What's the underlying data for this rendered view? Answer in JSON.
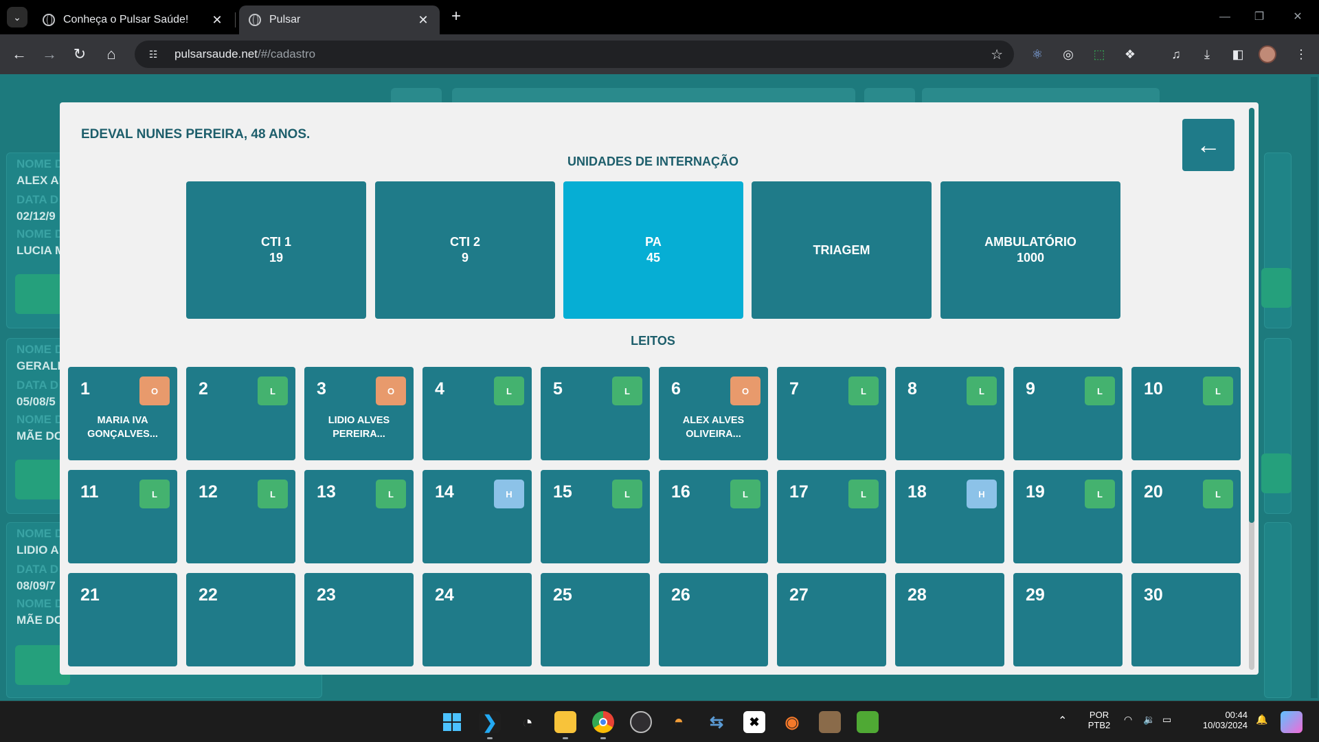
{
  "browser": {
    "tabs": [
      {
        "title": "Conheça o Pulsar Saúde!",
        "active": false
      },
      {
        "title": "Pulsar",
        "active": true
      }
    ],
    "url_host": "pulsarsaude.net",
    "url_path": "/#/cadastro"
  },
  "background_list": {
    "records": [
      {
        "lines": [
          "NOME D",
          "ALEX AL",
          "DATA D",
          "02/12/9",
          "NOME D",
          "LUCIA M"
        ]
      },
      {
        "lines": [
          "NOME D",
          "GERALD",
          "DATA D",
          "05/08/5",
          "NOME D",
          "MÃE DO"
        ]
      },
      {
        "lines": [
          "NOME D",
          "LIDIO A",
          "DATA D",
          "08/09/7",
          "NOME D",
          "MÃE DO"
        ]
      }
    ]
  },
  "modal": {
    "patient_title": "EDEVAL NUNES PEREIRA, 48 ANOS.",
    "units_heading": "UNIDADES DE INTERNAÇÃO",
    "beds_heading": "LEITOS",
    "units": [
      {
        "name": "CTI 1",
        "count": "19",
        "selected": false
      },
      {
        "name": "CTI 2",
        "count": "9",
        "selected": false
      },
      {
        "name": "PA",
        "count": "45",
        "selected": true
      },
      {
        "name": "TRIAGEM",
        "count": "",
        "selected": false
      },
      {
        "name": "AMBULATÓRIO",
        "count": "1000",
        "selected": false
      }
    ],
    "beds": [
      {
        "number": "1",
        "status": "O",
        "patient_line1": "MARIA IVA",
        "patient_line2": "GONÇALVES..."
      },
      {
        "number": "2",
        "status": "L",
        "patient_line1": "",
        "patient_line2": ""
      },
      {
        "number": "3",
        "status": "O",
        "patient_line1": "LIDIO ALVES",
        "patient_line2": "PEREIRA..."
      },
      {
        "number": "4",
        "status": "L",
        "patient_line1": "",
        "patient_line2": ""
      },
      {
        "number": "5",
        "status": "L",
        "patient_line1": "",
        "patient_line2": ""
      },
      {
        "number": "6",
        "status": "O",
        "patient_line1": "ALEX ALVES",
        "patient_line2": "OLIVEIRA..."
      },
      {
        "number": "7",
        "status": "L",
        "patient_line1": "",
        "patient_line2": ""
      },
      {
        "number": "8",
        "status": "L",
        "patient_line1": "",
        "patient_line2": ""
      },
      {
        "number": "9",
        "status": "L",
        "patient_line1": "",
        "patient_line2": ""
      },
      {
        "number": "10",
        "status": "L",
        "patient_line1": "",
        "patient_line2": ""
      },
      {
        "number": "11",
        "status": "L",
        "patient_line1": "",
        "patient_line2": ""
      },
      {
        "number": "12",
        "status": "L",
        "patient_line1": "",
        "patient_line2": ""
      },
      {
        "number": "13",
        "status": "L",
        "patient_line1": "",
        "patient_line2": ""
      },
      {
        "number": "14",
        "status": "H",
        "patient_line1": "",
        "patient_line2": ""
      },
      {
        "number": "15",
        "status": "L",
        "patient_line1": "",
        "patient_line2": ""
      },
      {
        "number": "16",
        "status": "L",
        "patient_line1": "",
        "patient_line2": ""
      },
      {
        "number": "17",
        "status": "L",
        "patient_line1": "",
        "patient_line2": ""
      },
      {
        "number": "18",
        "status": "H",
        "patient_line1": "",
        "patient_line2": ""
      },
      {
        "number": "19",
        "status": "L",
        "patient_line1": "",
        "patient_line2": ""
      },
      {
        "number": "20",
        "status": "L",
        "patient_line1": "",
        "patient_line2": ""
      },
      {
        "number": "21",
        "status": "",
        "patient_line1": "",
        "patient_line2": ""
      },
      {
        "number": "22",
        "status": "",
        "patient_line1": "",
        "patient_line2": ""
      },
      {
        "number": "23",
        "status": "",
        "patient_line1": "",
        "patient_line2": ""
      },
      {
        "number": "24",
        "status": "",
        "patient_line1": "",
        "patient_line2": ""
      },
      {
        "number": "25",
        "status": "",
        "patient_line1": "",
        "patient_line2": ""
      },
      {
        "number": "26",
        "status": "",
        "patient_line1": "",
        "patient_line2": ""
      },
      {
        "number": "27",
        "status": "",
        "patient_line1": "",
        "patient_line2": ""
      },
      {
        "number": "28",
        "status": "",
        "patient_line1": "",
        "patient_line2": ""
      },
      {
        "number": "29",
        "status": "",
        "patient_line1": "",
        "patient_line2": ""
      },
      {
        "number": "30",
        "status": "",
        "patient_line1": "",
        "patient_line2": ""
      }
    ]
  },
  "taskbar": {
    "lang_line1": "POR",
    "lang_line2": "PTB2",
    "time": "00:44",
    "date": "10/03/2024"
  },
  "colors": {
    "page_bg": "#1d7a7d",
    "card": "#1f7b89",
    "selected_unit": "#06aed4",
    "status_occupied": "#e89a6c",
    "status_free": "#44b26f",
    "status_h": "#8cc2e8",
    "title_text": "#1d5e6b"
  }
}
